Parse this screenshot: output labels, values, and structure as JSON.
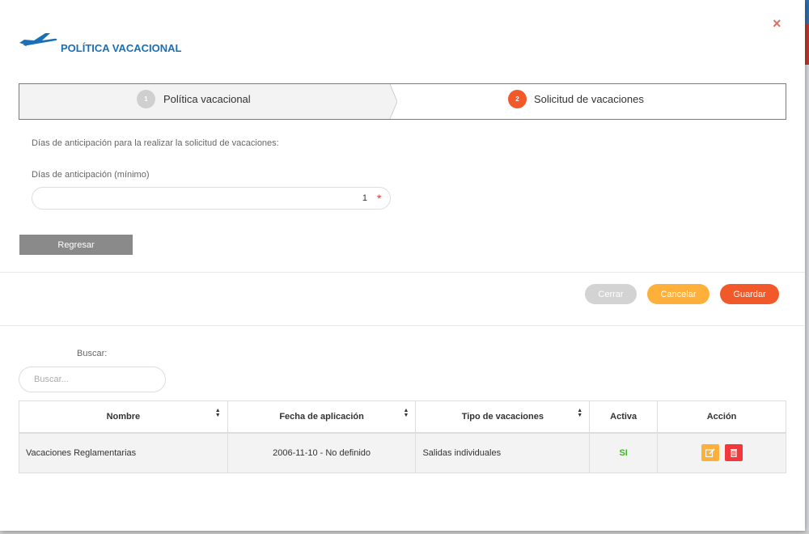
{
  "modal": {
    "title": "POLÍTICA VACACIONAL",
    "close_glyph": "×",
    "header_icon": "airplane-icon"
  },
  "wizard": {
    "steps": [
      {
        "number": "1",
        "label": "Política vacacional",
        "state": "completed"
      },
      {
        "number": "2",
        "label": "Solicitud de vacaciones",
        "state": "active"
      }
    ]
  },
  "form": {
    "description": "Días de anticipación para la realizar la solicitud de vacaciones:",
    "field_label": "Días de anticipación (mínimo)",
    "field_value": "1",
    "required_mark": "*",
    "back_button": "Regresar"
  },
  "footer": {
    "close_button": "Cerrar",
    "cancel_button": "Cancelar",
    "save_button": "Guardar"
  },
  "search": {
    "label": "Buscar:",
    "placeholder": "Buscar..."
  },
  "table": {
    "columns": [
      "Nombre",
      "Fecha de aplicación",
      "Tipo de vacaciones",
      "Activa",
      "Acción"
    ],
    "rows": [
      {
        "nombre": "Vacaciones Reglamentarias",
        "fecha": "2006-11-10 - No definido",
        "tipo": "Salidas individuales",
        "activa": "SI",
        "actions": [
          "edit-icon",
          "trash-icon"
        ]
      }
    ]
  },
  "colors": {
    "accent": "#f1592a",
    "title_blue": "#1a6fb5",
    "warning": "#ffb03b",
    "danger": "#f2383a",
    "success": "#3cb521"
  }
}
